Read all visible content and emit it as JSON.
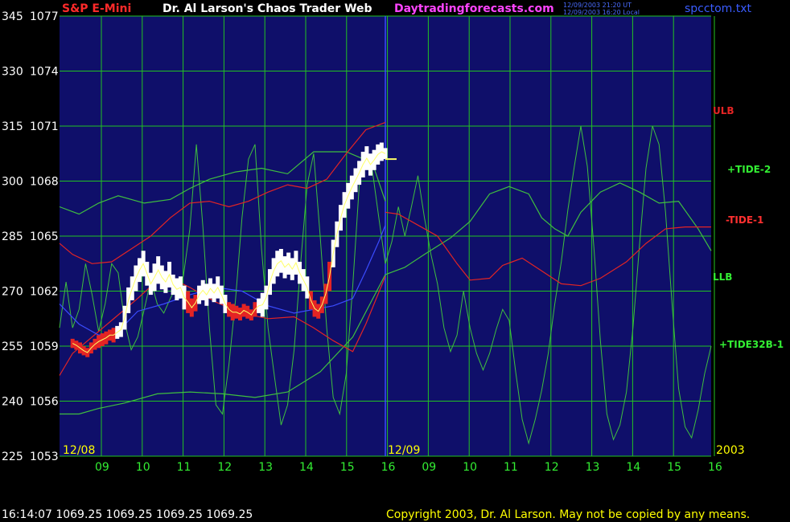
{
  "header": {
    "symbol": "S&P E-Mini",
    "title": "Dr. Al Larson's Chaos Trader Web",
    "site": "Daytradingforecasts.com",
    "stamp_line1": "12/09/2003 21:20 UT",
    "stamp_line2": "12/09/2003 16:20 Local",
    "file": "spcctom.txt"
  },
  "footer": {
    "quote": "16:14:07  1069.25  1069.25  1069.25  1069.25",
    "copyright": "Copyright 2003, Dr. Al Larson. May not be copied by any means."
  },
  "labels": {
    "ulb": "ULB",
    "tide2": "+TIDE-2",
    "tide1": "-TIDE-1",
    "llb": "LLB",
    "tide32b": "+TIDE32B-1"
  },
  "colors": {
    "background": "#000000",
    "plot_bg": "#0f0f6a",
    "grid": "#22c322",
    "axis_text": "#ffffff",
    "date_text": "#ffff00",
    "hour_text": "#33ee33",
    "red": "#e42424",
    "green": "#3fbf3f",
    "blue": "#3a4cff",
    "white": "#ffffff",
    "yellow": "#ffff66",
    "magenta": "#ff33ff"
  },
  "chart_data": {
    "type": "line",
    "ylim_price": [
      1053,
      1077
    ],
    "ylim_aux": [
      225,
      345
    ],
    "y_ticks_aux": [
      345,
      330,
      315,
      300,
      285,
      270,
      255,
      240,
      225
    ],
    "y_ticks_price": [
      1077,
      1074,
      1071,
      1068,
      1065,
      1062,
      1059,
      1056,
      1053
    ],
    "x_hour_labels": [
      "09",
      "10",
      "11",
      "12",
      "13",
      "14",
      "15",
      "16",
      "09",
      "10",
      "11",
      "12",
      "13",
      "14",
      "15",
      "16"
    ],
    "date_labels": [
      "12/08",
      "12/09",
      "2003"
    ],
    "price_bars": [
      [
        1058.9,
        1059.4,
        "r"
      ],
      [
        1058.8,
        1059.3,
        "r"
      ],
      [
        1058.6,
        1059.2,
        "r"
      ],
      [
        1058.5,
        1059.0,
        "r"
      ],
      [
        1058.4,
        1058.9,
        "r"
      ],
      [
        1058.6,
        1059.2,
        "r"
      ],
      [
        1058.8,
        1059.4,
        "r"
      ],
      [
        1058.9,
        1059.6,
        "r"
      ],
      [
        1059.0,
        1059.7,
        "r"
      ],
      [
        1059.1,
        1059.8,
        "r"
      ],
      [
        1059.3,
        1059.9,
        "r"
      ],
      [
        1059.2,
        1060.0,
        "r"
      ],
      [
        1059.4,
        1060.1,
        "w"
      ],
      [
        1059.5,
        1060.3,
        "w"
      ],
      [
        1059.9,
        1061.2,
        "w"
      ],
      [
        1060.8,
        1062.2,
        "w"
      ],
      [
        1061.5,
        1062.8,
        "w"
      ],
      [
        1062.0,
        1063.4,
        "w"
      ],
      [
        1062.5,
        1063.8,
        "w"
      ],
      [
        1062.8,
        1064.2,
        "w"
      ],
      [
        1062.3,
        1063.6,
        "w"
      ],
      [
        1061.8,
        1063.0,
        "w"
      ],
      [
        1062.0,
        1063.5,
        "w"
      ],
      [
        1062.4,
        1063.9,
        "w"
      ],
      [
        1062.1,
        1063.4,
        "w"
      ],
      [
        1061.9,
        1063.1,
        "w"
      ],
      [
        1062.2,
        1063.6,
        "w"
      ],
      [
        1061.8,
        1062.9,
        "w"
      ],
      [
        1061.5,
        1062.7,
        "w"
      ],
      [
        1061.6,
        1062.8,
        "w"
      ],
      [
        1061.0,
        1062.3,
        "w"
      ],
      [
        1060.8,
        1062.0,
        "r"
      ],
      [
        1060.6,
        1061.6,
        "r"
      ],
      [
        1060.9,
        1061.8,
        "r"
      ],
      [
        1061.3,
        1062.3,
        "w"
      ],
      [
        1061.5,
        1062.6,
        "w"
      ],
      [
        1061.2,
        1062.4,
        "w"
      ],
      [
        1061.6,
        1062.7,
        "w"
      ],
      [
        1061.4,
        1062.4,
        "w"
      ],
      [
        1061.6,
        1062.8,
        "w"
      ],
      [
        1061.3,
        1062.3,
        "w"
      ],
      [
        1060.8,
        1061.8,
        "w"
      ],
      [
        1060.6,
        1061.4,
        "r"
      ],
      [
        1060.4,
        1061.3,
        "r"
      ],
      [
        1060.5,
        1061.2,
        "r"
      ],
      [
        1060.4,
        1061.1,
        "r"
      ],
      [
        1060.6,
        1061.3,
        "r"
      ],
      [
        1060.5,
        1061.2,
        "r"
      ],
      [
        1060.4,
        1061.0,
        "r"
      ],
      [
        1060.6,
        1061.4,
        "r"
      ],
      [
        1060.8,
        1061.6,
        "w"
      ],
      [
        1060.6,
        1061.9,
        "w"
      ],
      [
        1061.0,
        1062.3,
        "w"
      ],
      [
        1061.8,
        1063.2,
        "w"
      ],
      [
        1062.4,
        1063.8,
        "w"
      ],
      [
        1062.8,
        1064.2,
        "w"
      ],
      [
        1063.0,
        1064.3,
        "w"
      ],
      [
        1062.7,
        1063.9,
        "w"
      ],
      [
        1062.9,
        1064.1,
        "w"
      ],
      [
        1062.6,
        1063.8,
        "w"
      ],
      [
        1062.9,
        1064.2,
        "w"
      ],
      [
        1062.4,
        1063.6,
        "w"
      ],
      [
        1062.0,
        1063.2,
        "w"
      ],
      [
        1061.6,
        1062.8,
        "w"
      ],
      [
        1061.0,
        1062.0,
        "r"
      ],
      [
        1060.6,
        1061.5,
        "r"
      ],
      [
        1060.5,
        1061.3,
        "r"
      ],
      [
        1060.8,
        1061.7,
        "r"
      ],
      [
        1061.3,
        1062.4,
        "r"
      ],
      [
        1062.0,
        1063.6,
        "r"
      ],
      [
        1063.3,
        1064.8,
        "w"
      ],
      [
        1064.4,
        1065.8,
        "w"
      ],
      [
        1065.3,
        1066.7,
        "w"
      ],
      [
        1066.0,
        1067.4,
        "w"
      ],
      [
        1066.5,
        1067.9,
        "w"
      ],
      [
        1067.0,
        1068.3,
        "w"
      ],
      [
        1067.4,
        1068.7,
        "w"
      ],
      [
        1067.8,
        1069.1,
        "w"
      ],
      [
        1068.2,
        1069.6,
        "w"
      ],
      [
        1068.6,
        1069.9,
        "w"
      ],
      [
        1068.3,
        1069.5,
        "w"
      ],
      [
        1068.6,
        1069.7,
        "w"
      ],
      [
        1068.9,
        1070.0,
        "w"
      ],
      [
        1069.1,
        1070.1,
        "w"
      ],
      [
        1069.2,
        1069.8,
        "w"
      ]
    ],
    "blue_line": [
      [
        1061.3,
        0
      ],
      [
        1060.2,
        0.03
      ],
      [
        1059.6,
        0.06
      ],
      [
        1059.8,
        0.09
      ],
      [
        1060.9,
        0.12
      ],
      [
        1061.3,
        0.16
      ],
      [
        1061.8,
        0.2
      ],
      [
        1062.2,
        0.24
      ],
      [
        1062.0,
        0.28
      ],
      [
        1061.2,
        0.32
      ],
      [
        1060.8,
        0.36
      ],
      [
        1061.0,
        0.39
      ],
      [
        1061.2,
        0.42
      ],
      [
        1061.6,
        0.45
      ],
      [
        1063.1,
        0.47
      ],
      [
        1064.7,
        0.49
      ],
      [
        1065.6,
        0.5
      ]
    ],
    "red_upper": [
      [
        1064.6,
        0
      ],
      [
        1064.0,
        0.02
      ],
      [
        1063.5,
        0.05
      ],
      [
        1063.6,
        0.08
      ],
      [
        1064.3,
        0.11
      ],
      [
        1065.0,
        0.14
      ],
      [
        1066.0,
        0.17
      ],
      [
        1066.8,
        0.2
      ],
      [
        1066.9,
        0.23
      ],
      [
        1066.6,
        0.26
      ],
      [
        1066.9,
        0.29
      ],
      [
        1067.4,
        0.32
      ],
      [
        1067.8,
        0.35
      ],
      [
        1067.6,
        0.38
      ],
      [
        1068.1,
        0.41
      ],
      [
        1069.5,
        0.44
      ],
      [
        1070.8,
        0.47
      ],
      [
        1071.2,
        0.5
      ]
    ],
    "red_lower": [
      [
        1057.4,
        0
      ],
      [
        1058.6,
        0.02
      ],
      [
        1059.5,
        0.05
      ],
      [
        1060.4,
        0.08
      ],
      [
        1061.6,
        0.12
      ],
      [
        1062.9,
        0.16
      ],
      [
        1062.2,
        0.2
      ],
      [
        1061.4,
        0.24
      ],
      [
        1060.8,
        0.28
      ],
      [
        1060.5,
        0.32
      ],
      [
        1060.6,
        0.36
      ],
      [
        1060.0,
        0.39
      ],
      [
        1059.3,
        0.42
      ],
      [
        1058.7,
        0.45
      ],
      [
        1060.2,
        0.47
      ],
      [
        1062.8,
        0.5
      ]
    ],
    "red_forecast": [
      [
        1066.3,
        0.5
      ],
      [
        1066.2,
        0.52
      ],
      [
        1065.6,
        0.55
      ],
      [
        1065.0,
        0.58
      ],
      [
        1063.5,
        0.61
      ],
      [
        1062.6,
        0.63
      ],
      [
        1062.7,
        0.66
      ],
      [
        1063.4,
        0.68
      ],
      [
        1063.8,
        0.71
      ],
      [
        1063.1,
        0.74
      ],
      [
        1062.4,
        0.77
      ],
      [
        1062.3,
        0.8
      ],
      [
        1062.7,
        0.83
      ],
      [
        1063.6,
        0.87
      ],
      [
        1064.6,
        0.9
      ],
      [
        1065.4,
        0.93
      ],
      [
        1065.5,
        0.96
      ],
      [
        1065.5,
        1.0
      ]
    ],
    "green_upper": [
      [
        1066.6,
        0
      ],
      [
        1066.2,
        0.03
      ],
      [
        1066.8,
        0.06
      ],
      [
        1067.2,
        0.09
      ],
      [
        1066.8,
        0.13
      ],
      [
        1067.0,
        0.17
      ],
      [
        1067.6,
        0.2
      ],
      [
        1068.1,
        0.23
      ],
      [
        1068.5,
        0.27
      ],
      [
        1068.7,
        0.31
      ],
      [
        1068.4,
        0.35
      ],
      [
        1069.6,
        0.39
      ],
      [
        1069.6,
        0.44
      ],
      [
        1069.0,
        0.48
      ],
      [
        1066.9,
        0.5
      ]
    ],
    "green_lower": [
      [
        1055.3,
        0
      ],
      [
        1055.3,
        0.03
      ],
      [
        1055.6,
        0.06
      ],
      [
        1055.9,
        0.1
      ],
      [
        1056.4,
        0.15
      ],
      [
        1056.5,
        0.2
      ],
      [
        1056.4,
        0.25
      ],
      [
        1056.2,
        0.3
      ],
      [
        1056.5,
        0.35
      ],
      [
        1057.6,
        0.4
      ],
      [
        1059.5,
        0.45
      ],
      [
        1062.9,
        0.5
      ]
    ],
    "green_forecast": [
      [
        1062.9,
        0.5
      ],
      [
        1063.3,
        0.53
      ],
      [
        1064.0,
        0.56
      ],
      [
        1064.9,
        0.6
      ],
      [
        1065.8,
        0.63
      ],
      [
        1067.3,
        0.66
      ],
      [
        1067.7,
        0.69
      ],
      [
        1067.3,
        0.72
      ],
      [
        1066.0,
        0.74
      ],
      [
        1065.4,
        0.76
      ],
      [
        1065.0,
        0.78
      ],
      [
        1066.3,
        0.8
      ],
      [
        1067.4,
        0.83
      ],
      [
        1067.9,
        0.86
      ],
      [
        1067.4,
        0.89
      ],
      [
        1066.8,
        0.92
      ],
      [
        1066.9,
        0.95
      ],
      [
        1065.4,
        0.98
      ],
      [
        1064.2,
        1.0
      ]
    ],
    "tide_osc": [
      [
        1060.0,
        0
      ],
      [
        1062.5,
        0.01
      ],
      [
        1060.0,
        0.02
      ],
      [
        1061.0,
        0.03
      ],
      [
        1063.5,
        0.04
      ],
      [
        1061.8,
        0.05
      ],
      [
        1059.8,
        0.06
      ],
      [
        1061.3,
        0.07
      ],
      [
        1063.5,
        0.08
      ],
      [
        1063.0,
        0.09
      ],
      [
        1060.3,
        0.1
      ],
      [
        1058.8,
        0.11
      ],
      [
        1059.5,
        0.12
      ],
      [
        1061.0,
        0.13
      ],
      [
        1062.6,
        0.14
      ],
      [
        1061.3,
        0.15
      ],
      [
        1060.8,
        0.16
      ],
      [
        1061.6,
        0.17
      ],
      [
        1062.3,
        0.18
      ],
      [
        1062.8,
        0.19
      ],
      [
        1065.4,
        0.2
      ],
      [
        1070.0,
        0.21
      ],
      [
        1065.5,
        0.22
      ],
      [
        1060.0,
        0.23
      ],
      [
        1055.8,
        0.24
      ],
      [
        1055.3,
        0.25
      ],
      [
        1058.0,
        0.26
      ],
      [
        1061.5,
        0.27
      ],
      [
        1066.0,
        0.28
      ],
      [
        1069.2,
        0.29
      ],
      [
        1070.0,
        0.3
      ],
      [
        1064.3,
        0.31
      ],
      [
        1060.0,
        0.32
      ],
      [
        1057.3,
        0.33
      ],
      [
        1054.7,
        0.34
      ],
      [
        1055.8,
        0.35
      ],
      [
        1058.8,
        0.36
      ],
      [
        1063.5,
        0.37
      ],
      [
        1067.8,
        0.38
      ],
      [
        1069.5,
        0.39
      ],
      [
        1065.0,
        0.4
      ],
      [
        1060.0,
        0.41
      ],
      [
        1056.2,
        0.42
      ],
      [
        1055.3,
        0.43
      ],
      [
        1057.5,
        0.44
      ],
      [
        1062.3,
        0.45
      ],
      [
        1067.8,
        0.46
      ],
      [
        1069.5,
        0.47
      ],
      [
        1068.6,
        0.48
      ],
      [
        1066.0,
        0.49
      ],
      [
        1063.5,
        0.5
      ],
      [
        1064.7,
        0.51
      ],
      [
        1066.6,
        0.52
      ],
      [
        1065.0,
        0.53
      ],
      [
        1066.6,
        0.54
      ],
      [
        1068.3,
        0.55
      ],
      [
        1066.0,
        0.56
      ],
      [
        1064.0,
        0.57
      ],
      [
        1062.4,
        0.58
      ],
      [
        1060.0,
        0.59
      ],
      [
        1058.7,
        0.6
      ],
      [
        1059.6,
        0.61
      ],
      [
        1062.0,
        0.62
      ],
      [
        1060.0,
        0.63
      ],
      [
        1058.6,
        0.64
      ],
      [
        1057.7,
        0.65
      ],
      [
        1058.6,
        0.66
      ],
      [
        1059.9,
        0.67
      ],
      [
        1061.0,
        0.68
      ],
      [
        1060.4,
        0.69
      ],
      [
        1057.6,
        0.7
      ],
      [
        1055.0,
        0.71
      ],
      [
        1053.7,
        0.72
      ],
      [
        1055.0,
        0.73
      ],
      [
        1056.6,
        0.74
      ],
      [
        1058.6,
        0.75
      ],
      [
        1061.3,
        0.76
      ],
      [
        1063.6,
        0.77
      ],
      [
        1066.4,
        0.78
      ],
      [
        1068.8,
        0.79
      ],
      [
        1071.0,
        0.8
      ],
      [
        1068.8,
        0.81
      ],
      [
        1064.4,
        0.82
      ],
      [
        1059.3,
        0.83
      ],
      [
        1055.3,
        0.84
      ],
      [
        1053.9,
        0.85
      ],
      [
        1054.7,
        0.86
      ],
      [
        1056.5,
        0.87
      ],
      [
        1060.0,
        0.88
      ],
      [
        1064.5,
        0.89
      ],
      [
        1068.7,
        0.9
      ],
      [
        1071.0,
        0.91
      ],
      [
        1070.0,
        0.92
      ],
      [
        1066.3,
        0.93
      ],
      [
        1061.3,
        0.94
      ],
      [
        1056.7,
        0.95
      ],
      [
        1054.6,
        0.96
      ],
      [
        1054.0,
        0.97
      ],
      [
        1055.5,
        0.98
      ],
      [
        1057.5,
        0.99
      ],
      [
        1059.0,
        1.0
      ]
    ],
    "last_price": 1069.2
  }
}
